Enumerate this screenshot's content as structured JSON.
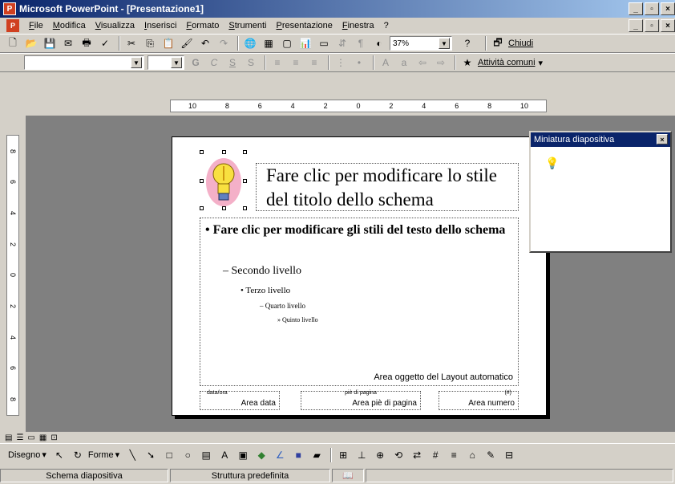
{
  "window": {
    "app_icon": "powerpoint-icon",
    "title": "Microsoft PowerPoint - [Presentazione1]",
    "min": "_",
    "max": "▫",
    "close": "×"
  },
  "menu": {
    "items": [
      "File",
      "Modifica",
      "Visualizza",
      "Inserisci",
      "Formato",
      "Strumenti",
      "Presentazione",
      "Finestra",
      "?"
    ]
  },
  "toolbar_standard": {
    "zoom": "37%",
    "help": "?",
    "close_label": "Chiudi"
  },
  "toolbar_format": {
    "font_name": "",
    "font_size": "",
    "tasks_label": "Attività comuni"
  },
  "ruler": {
    "labels": [
      "10",
      "8",
      "6",
      "4",
      "2",
      "0",
      "2",
      "4",
      "6",
      "8",
      "10"
    ],
    "vlabels": [
      "8",
      "6",
      "4",
      "2",
      "0",
      "2",
      "4",
      "6",
      "8"
    ]
  },
  "slide": {
    "title": "Fare clic per modificare lo stile del titolo dello schema",
    "level1": "Fare clic per modificare gli stili del testo dello schema",
    "level2": "Secondo livello",
    "level3": "Terzo livello",
    "level4": "Quarto livello",
    "level5": "Quinto livello",
    "auto_area": "Area oggetto del Layout automatico",
    "date_tag": "data/ora",
    "date_label": "Area data",
    "footer_tag": "piè di pagina",
    "footer_label": "Area piè di pagina",
    "number_tag": "(#)",
    "number_label": "Area numero"
  },
  "mini_panel": {
    "title": "Miniatura diapositiva",
    "close": "×"
  },
  "drawing_toolbar": {
    "draw_label": "Disegno",
    "shapes_label": "Forme"
  },
  "status": {
    "view": "Schema diapositiva",
    "design": "Struttura predefinita"
  }
}
